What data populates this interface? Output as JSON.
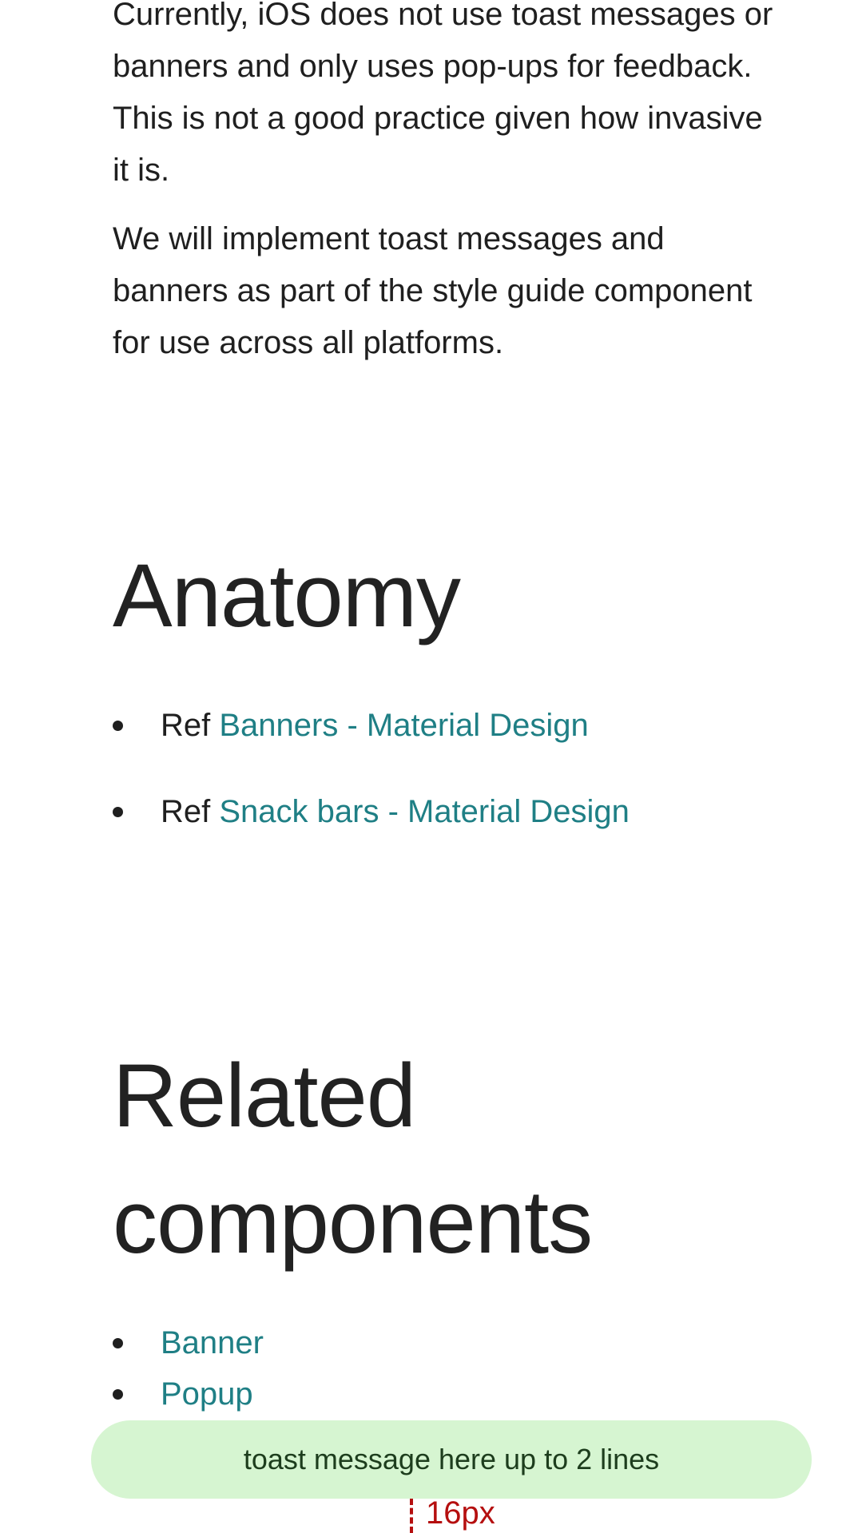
{
  "intro": {
    "paragraph_1": "Currently, iOS does not use toast messages or banners and only uses pop-ups for feedback. This is not a good practice given how invasive it is.",
    "paragraph_2": "We will implement toast messages and banners as part of the style guide component for use across all platforms."
  },
  "anatomy": {
    "heading": "Anatomy",
    "refs": [
      {
        "prefix": "Ref ",
        "link": "Banners - Material Design"
      },
      {
        "prefix": "Ref ",
        "link": "Snack bars - Material Design"
      }
    ]
  },
  "related": {
    "heading": "Related components",
    "items": [
      {
        "label": "Banner"
      },
      {
        "label": "Popup"
      }
    ]
  },
  "toast": {
    "text": "toast message here up to 2 lines",
    "spacing_label": "16px"
  },
  "colors": {
    "link": "#1f7f85",
    "toast_background": "#d6f5d1",
    "spacing_annotation": "#b50f0f"
  }
}
